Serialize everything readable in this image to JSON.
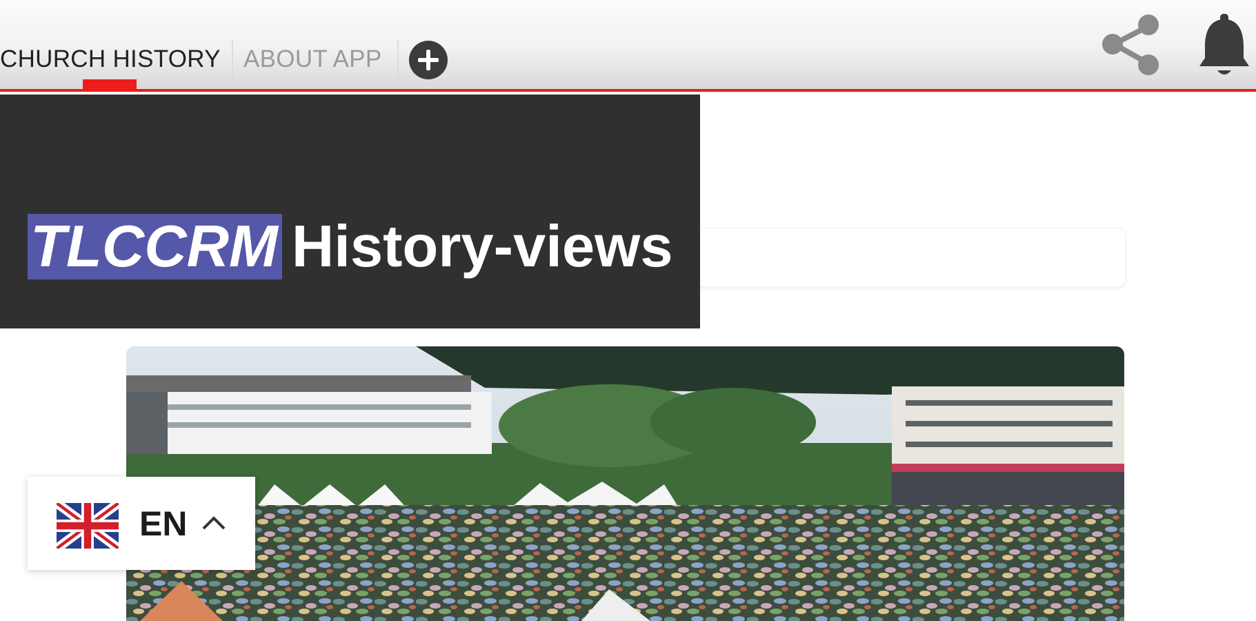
{
  "tabs": [
    {
      "label": "CHURCH HISTORY",
      "active": true
    },
    {
      "label": "ABOUT APP",
      "active": false
    }
  ],
  "icons": {
    "add_tab": "plus-circle-icon",
    "share": "share-icon",
    "notifications": "bell-icon",
    "language_flag": "uk-flag-icon",
    "language_toggle": "chevron-up-icon"
  },
  "hero": {
    "brand": "TLCCRM",
    "title": "History-views"
  },
  "language": {
    "code": "EN"
  },
  "colors": {
    "accent": "#e91e1e",
    "hero_background": "#303030",
    "brand_highlight": "#5557a8"
  }
}
